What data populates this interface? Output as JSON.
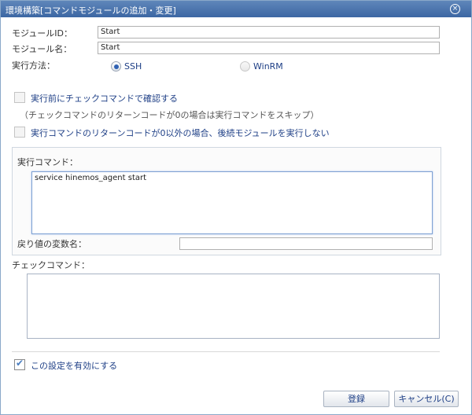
{
  "window": {
    "title": "環境構築[コマンドモジュールの追加・変更]",
    "close_symbol": "×"
  },
  "module_id": {
    "label": "モジュールID：",
    "value": "Start"
  },
  "module_name": {
    "label": "モジュール名：",
    "value": "Start"
  },
  "exec_method": {
    "label": "実行方法：",
    "options": [
      {
        "label": "SSH",
        "selected": true
      },
      {
        "label": "WinRM",
        "selected": false
      }
    ]
  },
  "check_before": {
    "label": "実行前にチェックコマンドで確認する",
    "note": "（チェックコマンドのリターンコードが0の場合は実行コマンドをスキップ）",
    "checked": false
  },
  "stop_on_error": {
    "label": "実行コマンドのリターンコードが0以外の場合、後続モジュールを実行しない",
    "checked": false
  },
  "exec_command": {
    "label": "実行コマンド：",
    "value": "service hinemos_agent start"
  },
  "return_var": {
    "label": "戻り値の変数名：",
    "value": ""
  },
  "check_command": {
    "label": "チェックコマンド：",
    "value": ""
  },
  "enable": {
    "label": "この設定を有効にする",
    "checked": true
  },
  "buttons": {
    "register": "登録",
    "cancel": "キャンセル(C)"
  }
}
